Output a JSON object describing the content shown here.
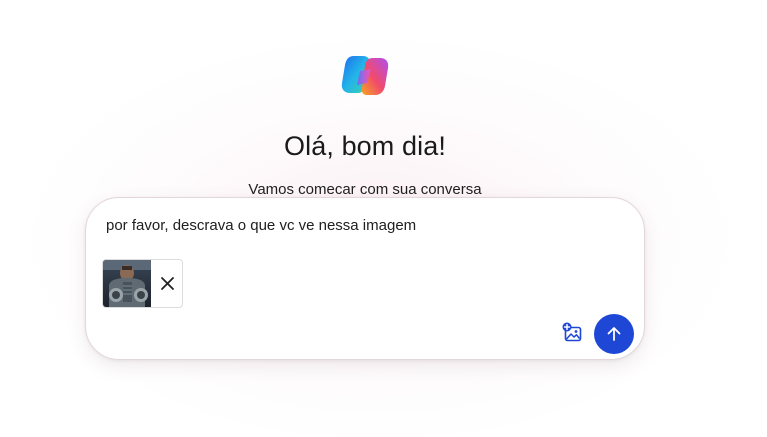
{
  "greeting": {
    "title": "Olá, bom dia!",
    "subtitle": "Vamos comecar com sua conversa"
  },
  "composer": {
    "message": "por favor, descrava o que vc ve nessa imagem",
    "attachments": [
      {
        "type": "image"
      }
    ]
  },
  "icons": {
    "logo": "copilot-logo",
    "remove": "close-icon",
    "add_image": "add-image-icon",
    "send": "arrow-up-icon"
  },
  "colors": {
    "send_button": "#1f47d6",
    "add_image_icon": "#1f47d6",
    "text": "#1b1b1b"
  }
}
